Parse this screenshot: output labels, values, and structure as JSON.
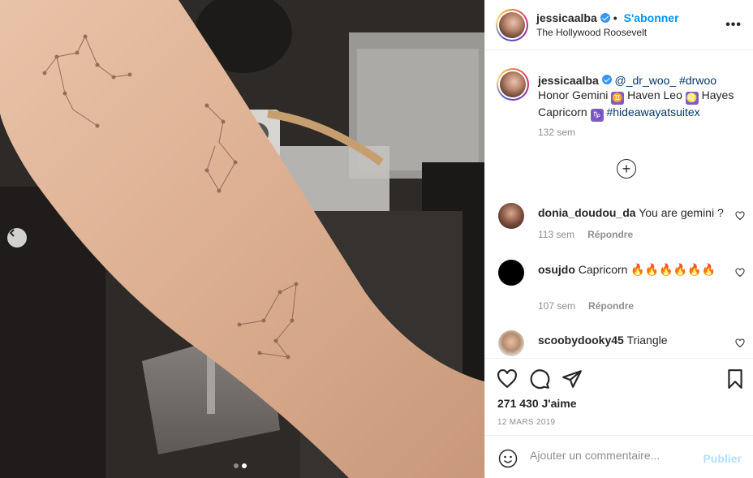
{
  "post": {
    "username": "jessicaalba",
    "follow_label": "S'abonner",
    "separator": "•",
    "location": "The Hollywood Roosevelt",
    "more_label": "•••"
  },
  "caption": {
    "username": "jessicaalba",
    "mention": "@_dr_woo_",
    "hashtag1": "#drwoo",
    "text1": "Honor Gemini",
    "emoji1": "♊",
    "text2": "Haven Leo",
    "emoji2": "♌",
    "text3": "Hayes",
    "text4": "Capricorn",
    "emoji3": "♑",
    "hashtag2": "#hideawayatsuitex",
    "time": "132 sem"
  },
  "load_more_label": "+",
  "comments": [
    {
      "username": "donia_doudou_da",
      "text": "You are gemini ?",
      "time": "113 sem",
      "reply": "Répondre"
    },
    {
      "username": "osujdo",
      "text": "Capricorn 🔥🔥🔥🔥🔥🔥",
      "time": "107 sem",
      "reply": "Répondre"
    },
    {
      "username": "scoobydooky45",
      "text": "Triangle"
    }
  ],
  "likes_label": "271 430 J'aime",
  "date_label": "12 MARS 2019",
  "comment_input": {
    "placeholder": "Ajouter un commentaire...",
    "value": ""
  },
  "publish_label": "Publier",
  "carousel": {
    "slides": 2,
    "active": 2
  },
  "colors": {
    "accent": "#0095f6",
    "muted": "#8e8e8e",
    "publish_disabled": "#b2dffc",
    "border": "#efefef"
  }
}
